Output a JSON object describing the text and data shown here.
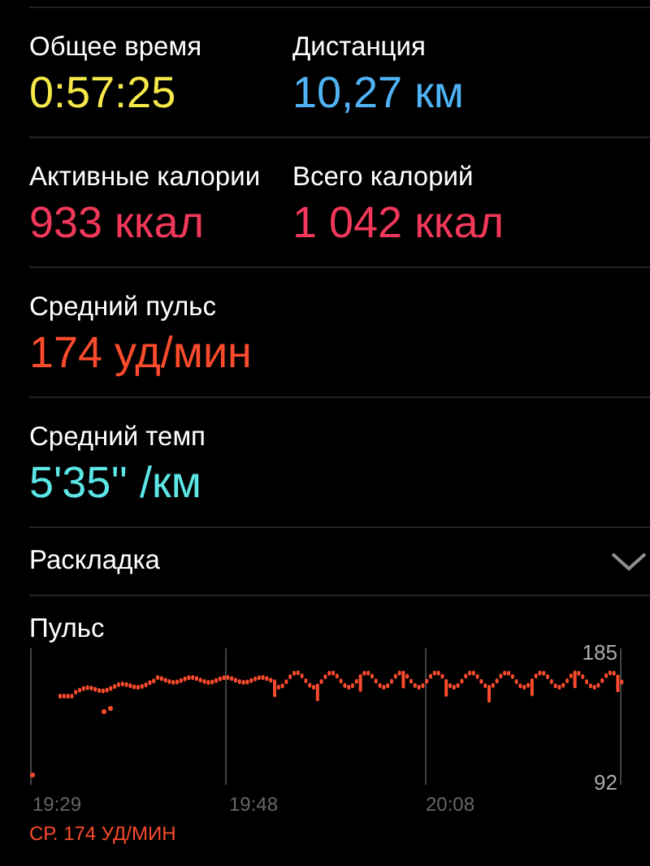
{
  "metrics": [
    {
      "cells": [
        {
          "label": "Общее время",
          "value": "0:57:25",
          "color": "#f5e94a"
        },
        {
          "label": "Дистанция",
          "value": "10,27 км",
          "color": "#4fb3f5"
        }
      ]
    },
    {
      "cells": [
        {
          "label": "Активные калории",
          "value": "933 ккал",
          "color": "#f2385a"
        },
        {
          "label": "Всего калорий",
          "value": "1 042 ккал",
          "color": "#f2385a"
        }
      ]
    },
    {
      "cells": [
        {
          "label": "Средний пульс",
          "value": "174 уд/мин",
          "color": "#fb4b2c"
        }
      ]
    },
    {
      "cells": [
        {
          "label": "Средний темп",
          "value": "5'35'' /км",
          "color": "#5de6e6"
        }
      ]
    }
  ],
  "splits": {
    "label": "Раскладка",
    "expanded": false
  },
  "heart_rate": {
    "title": "Пульс",
    "max_label": "185",
    "min_label": "92",
    "time_labels": [
      "19:29",
      "19:48",
      "20:08"
    ],
    "average": "СР. 174 УД/МИН"
  }
}
